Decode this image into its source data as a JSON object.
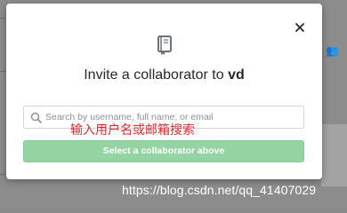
{
  "dialog": {
    "title_prefix": "Invite a collaborator to ",
    "repo_name": "vd",
    "search_placeholder": "Search by username, full name, or email",
    "search_value": "",
    "submit_label": "Select a collaborator above",
    "close_icon": "close-icon",
    "book_icon": "repo-book-icon"
  },
  "annotation": {
    "text": "输入用户名或邮箱搜索",
    "color": "#e8262a"
  },
  "watermark": {
    "text": "https://blog.csdn.net/qq_41407029"
  },
  "background": {
    "user_icon": "people-icon"
  },
  "colors": {
    "submit_bg": "#94d3a2",
    "overlay": "#8c8c8c"
  }
}
